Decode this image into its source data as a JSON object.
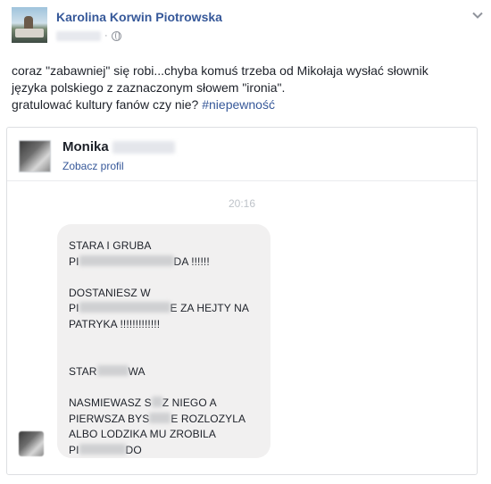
{
  "post": {
    "author": "Karolina Korwin Piotrowska",
    "separator": "·",
    "text_lines": [
      "coraz \"zabawniej\" się robi...chyba komuś trzeba od Mikołaja wysłać słownik",
      "języka polskiego z zaznaczonym słowem \"ironia\".",
      "gratulować kultury fanów czy nie? "
    ],
    "hashtag": "#niepewność"
  },
  "card": {
    "name": "Monika",
    "see_profile": "Zobacz profil",
    "time": "20:16",
    "message": {
      "l1": "STARA I GRUBA",
      "l2a": "PI",
      "l2b": "DA  !!!!!!",
      "l3": "DOSTANIESZ W",
      "l4a": "PI",
      "l4b": "E ZA HEJTY NA",
      "l5": "PATRYKA !!!!!!!!!!!!!",
      "l6a": "STAR",
      "l6b": "WA",
      "l7a": "NASMIEWASZ S",
      "l7b": "Z NIEGO A",
      "l8a": "PIERWSZA BYS",
      "l8b": "E ROZLOZYLA",
      "l9": "ALBO LODZIKA MU ZROBILA",
      "l10a": "PI",
      "l10b": "DO"
    }
  }
}
